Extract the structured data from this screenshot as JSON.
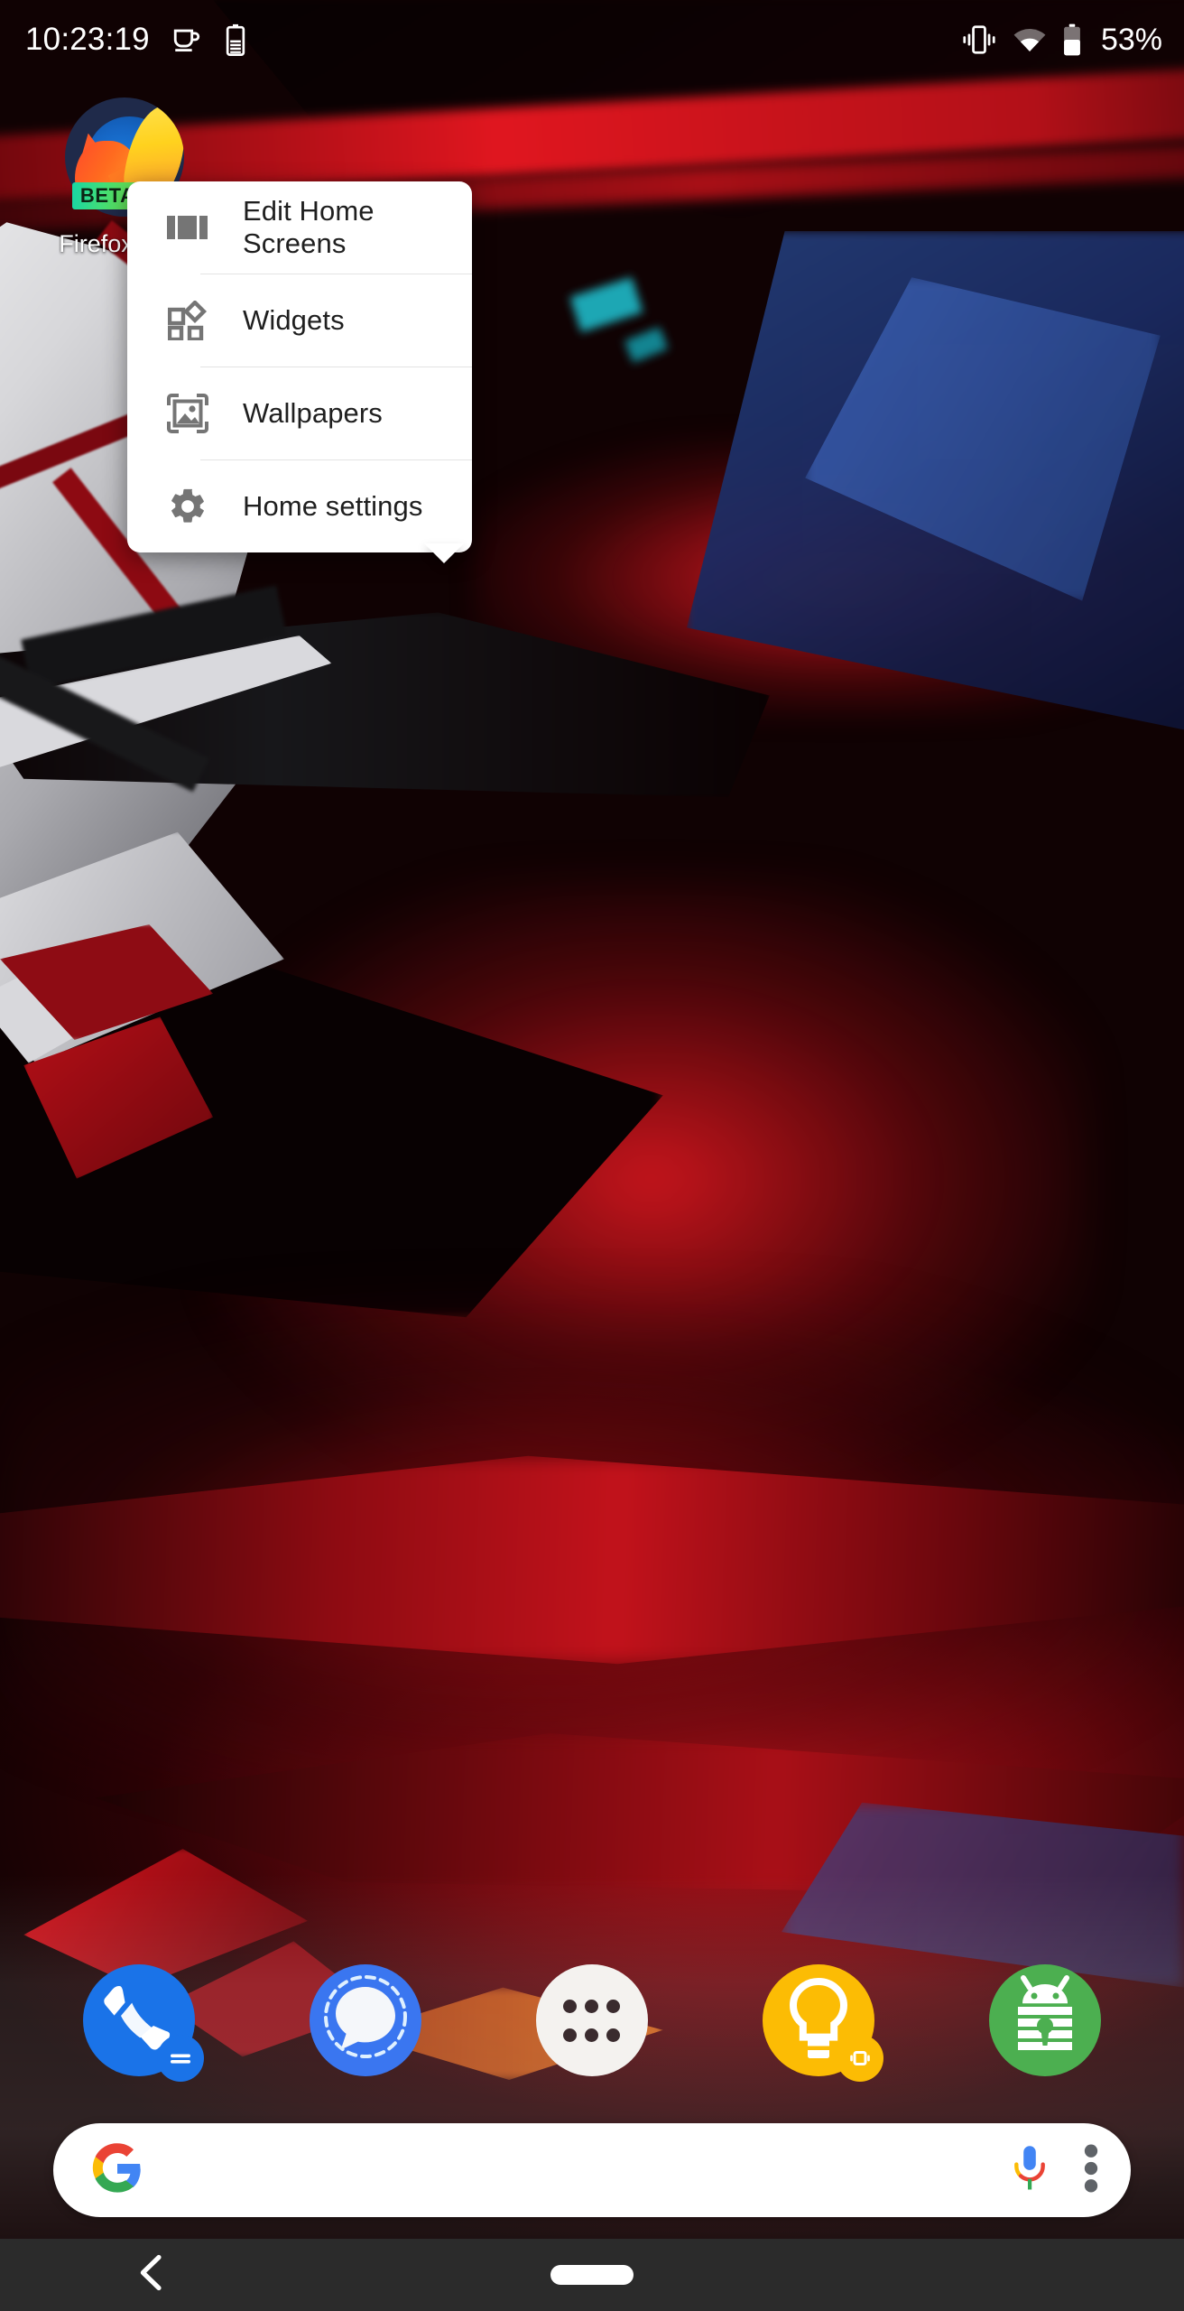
{
  "status_bar": {
    "clock": "10:23:19",
    "left_icons": [
      {
        "name": "caffeine-icon",
        "label": "Caffeine"
      },
      {
        "name": "battery-saver-icon",
        "label": "Battery saver"
      }
    ],
    "right_icons": [
      {
        "name": "vibrate-icon",
        "label": "Vibrate"
      },
      {
        "name": "wifi-icon",
        "label": "Wi-Fi"
      },
      {
        "name": "battery-icon",
        "label": "Battery"
      }
    ],
    "battery_percent": "53%"
  },
  "home": {
    "app_icon": {
      "label": "Firefox Beta",
      "badge": "BETA",
      "icon_name": "firefox-beta-icon"
    }
  },
  "popup_menu": {
    "items": [
      {
        "label": "Edit Home Screens",
        "icon": "edit-home-screens-icon"
      },
      {
        "label": "Widgets",
        "icon": "widgets-icon"
      },
      {
        "label": "Wallpapers",
        "icon": "wallpapers-icon"
      },
      {
        "label": "Home settings",
        "icon": "gear-icon"
      }
    ]
  },
  "dock": {
    "items": [
      {
        "label": "Phone",
        "icon": "phone-icon",
        "badge": "work-badge"
      },
      {
        "label": "Signal",
        "icon": "signal-icon",
        "badge": ""
      },
      {
        "label": "All apps",
        "icon": "app-drawer-icon",
        "badge": ""
      },
      {
        "label": "Keep Notes",
        "icon": "keep-icon",
        "badge": "work-badge"
      },
      {
        "label": "Keepass",
        "icon": "keepass-icon",
        "badge": ""
      }
    ]
  },
  "search": {
    "placeholder": "",
    "value": "",
    "google_logo": "google-g-icon",
    "mic": "google-mic-icon",
    "overflow": "more-options-icon"
  },
  "navigation_bar": {
    "back": "back-icon",
    "home_pill": "home-gesture-pill"
  },
  "colors": {
    "accent_red": "#c4151d",
    "popup_bg": "#ffffff",
    "popup_text": "#1f1f1f",
    "popup_icon": "#757575",
    "nav_bg": "#2b2b2b",
    "phone_blue": "#1a73e8",
    "signal_blue": "#3a76f0",
    "keep_yellow": "#fcbc04",
    "keepass_green": "#4caf50"
  }
}
